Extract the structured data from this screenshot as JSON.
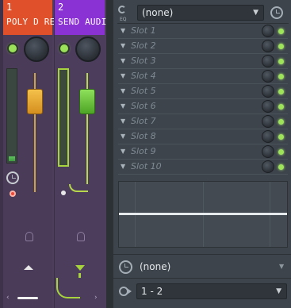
{
  "mixer": {
    "tracks": [
      {
        "number": "1",
        "name": "POLY D REC",
        "color": "#e0502a",
        "fader_color": "#e2a22a"
      },
      {
        "number": "2",
        "name": "SEND AUDIO",
        "color": "#8a32d4",
        "fader_color": "#6fbf2d"
      }
    ]
  },
  "effects": {
    "eq_label": "EQ",
    "preset": "(none)",
    "slots": [
      "Slot 1",
      "Slot 2",
      "Slot 3",
      "Slot 4",
      "Slot 5",
      "Slot 6",
      "Slot 7",
      "Slot 8",
      "Slot 9",
      "Slot 10"
    ],
    "bottom_preset": "(none)",
    "routing": "1 - 2"
  }
}
